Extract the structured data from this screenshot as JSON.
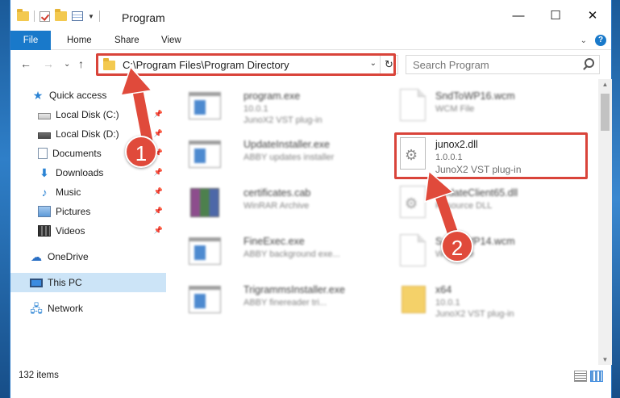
{
  "window": {
    "title": "Program",
    "controls": {
      "minimize": "—",
      "maximize": "☐",
      "close": "✕"
    }
  },
  "ribbon": {
    "tabs": [
      "File",
      "Home",
      "Share",
      "View"
    ],
    "help": "?",
    "collapse": "⌄"
  },
  "navigation": {
    "back": "←",
    "forward": "→",
    "recent": "⌄",
    "up": "↑",
    "address": "C:\\Program Files\\Program Directory",
    "refresh": "↻",
    "search_placeholder": "Search Program"
  },
  "sidebar": {
    "items": [
      {
        "label": "Quick access",
        "icon": "star-icon"
      },
      {
        "label": "Local Disk (C:)",
        "icon": "drive-icon",
        "pinned": true
      },
      {
        "label": "Local Disk (D:)",
        "icon": "drive-icon",
        "pinned": true
      },
      {
        "label": "Documents",
        "icon": "documents-icon",
        "pinned": true
      },
      {
        "label": "Downloads",
        "icon": "download-icon",
        "pinned": true
      },
      {
        "label": "Music",
        "icon": "music-icon",
        "pinned": true
      },
      {
        "label": "Pictures",
        "icon": "pictures-icon",
        "pinned": true
      },
      {
        "label": "Videos",
        "icon": "videos-icon",
        "pinned": true
      },
      {
        "label": "OneDrive",
        "icon": "cloud-icon"
      },
      {
        "label": "This PC",
        "icon": "computer-icon",
        "selected": true
      },
      {
        "label": "Network",
        "icon": "network-icon"
      }
    ]
  },
  "files": [
    {
      "name": "program.exe",
      "type": "10.0.1",
      "desc": "JunoX2 VST plug-in",
      "icon": "exe-icon"
    },
    {
      "name": "SndToWP16.wcm",
      "type": "WCM File",
      "desc": "",
      "icon": "document-icon"
    },
    {
      "name": "UpdateInstaller.exe",
      "type": "ABBY updates installer",
      "desc": "",
      "icon": "exe-icon"
    },
    {
      "name": "junox2.dll",
      "type": "1.0.0.1",
      "desc": "JunoX2 VST plug-in",
      "icon": "gear-document-icon"
    },
    {
      "name": "certificates.cab",
      "type": "WinRAR Archive",
      "desc": "",
      "icon": "rar-icon"
    },
    {
      "name": "UpdateClient65.dll",
      "type": "Resource DLL",
      "desc": "",
      "icon": "gear-document-icon"
    },
    {
      "name": "FineExec.exe",
      "type": "ABBY background exe...",
      "desc": "",
      "icon": "exe-icon"
    },
    {
      "name": "SndToWP14.wcm",
      "type": "WCM File",
      "desc": "",
      "icon": "document-icon"
    },
    {
      "name": "TrigrammsInstaller.exe",
      "type": "ABBY finereader tri...",
      "desc": "",
      "icon": "exe-icon"
    },
    {
      "name": "x64",
      "type": "10.0.1",
      "desc": "JunoX2 VST plug-in",
      "icon": "folder-icon"
    }
  ],
  "status": {
    "item_count": "132 items"
  },
  "callouts": {
    "one": "1",
    "two": "2"
  },
  "colors": {
    "accent": "#1979ca",
    "highlight": "#d9443a",
    "selected": "#cce4f7"
  }
}
